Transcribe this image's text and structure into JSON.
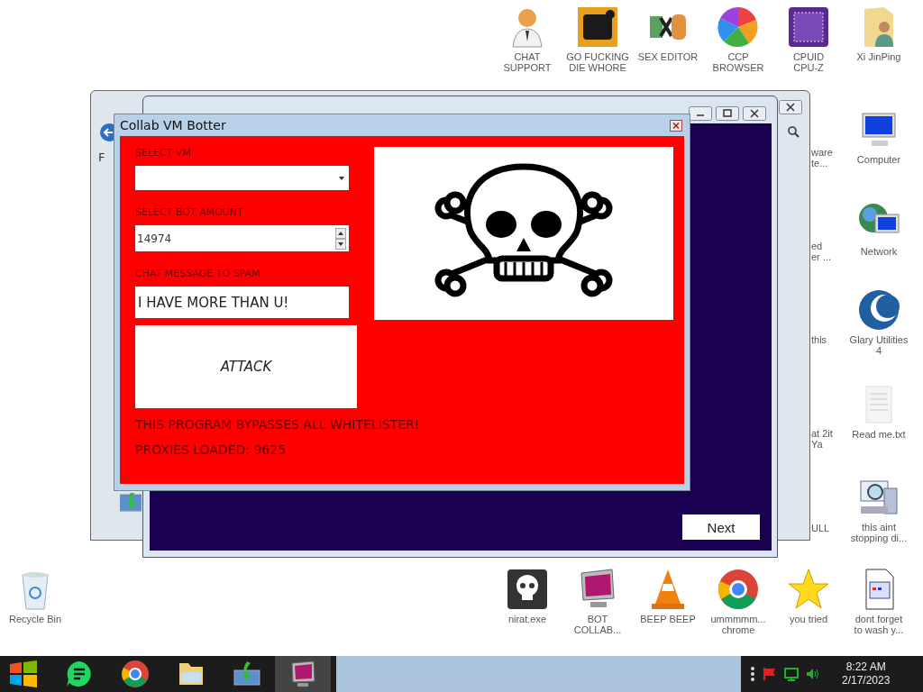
{
  "desktop": {
    "top_row": [
      {
        "label": "CHAT\nSUPPORT",
        "kind": "doctor"
      },
      {
        "label": "GO FUCKING\nDIE WHORE",
        "kind": "orange-app"
      },
      {
        "label": "SEX EDITOR",
        "kind": "hex"
      },
      {
        "label": "CCP\nBROWSER",
        "kind": "pinwheel"
      },
      {
        "label": "CPUID\nCPU-Z",
        "kind": "chip"
      },
      {
        "label": "Xi JinPing",
        "kind": "user-folder"
      }
    ],
    "right_column": [
      {
        "label": "Computer",
        "kind": "computer"
      },
      {
        "label": "Network",
        "kind": "network"
      },
      {
        "label": "Glary Utilities\n4",
        "kind": "glary"
      },
      {
        "label": "Read me.txt",
        "kind": "text-file"
      },
      {
        "label": "this aint\nstopping di...",
        "kind": "inspector"
      }
    ],
    "partial_labels": [
      "ware\nte...",
      "ed\ner ...",
      "this",
      "at 2it\nYa",
      "ULL"
    ],
    "bottom_left": [
      {
        "label": "Recycle Bin",
        "kind": "recycle"
      }
    ],
    "bottom_row": [
      {
        "label": "nirat.exe",
        "kind": "skull"
      },
      {
        "label": "BOT\nCOLLAB...",
        "kind": "monitor"
      },
      {
        "label": "BEEP BEEP",
        "kind": "cone"
      },
      {
        "label": "ummmmm...\nchrome",
        "kind": "chrome"
      },
      {
        "label": "you tried",
        "kind": "star"
      },
      {
        "label": "dont forget\nto wash y...",
        "kind": "doc"
      }
    ]
  },
  "back_window": {
    "menu_letter": "F"
  },
  "setup_window": {
    "next_button": "Next"
  },
  "botter_window": {
    "title": "Collab VM Botter",
    "vm_label": "SELECT VM",
    "amount_label": "SELECT BOT AMOUNT",
    "amount_value": "14974",
    "message_label": "CHAT MESSAGE TO SPAM",
    "message_value": "I HAVE MORE THAN U!",
    "attack_button": "ATTACK",
    "bypass_text": "THIS PROGRAM BYPASSES ALL WHITELISTER!",
    "proxies_text": "PROXIES LOADED: 9625"
  },
  "taskbar": {
    "apps": [
      {
        "kind": "chat",
        "selected": false
      },
      {
        "kind": "chrome",
        "selected": false
      },
      {
        "kind": "folder",
        "selected": false
      },
      {
        "kind": "installer",
        "selected": false
      },
      {
        "kind": "monitor",
        "selected": true
      }
    ],
    "time": "8:22 AM",
    "date": "2/17/2023"
  }
}
